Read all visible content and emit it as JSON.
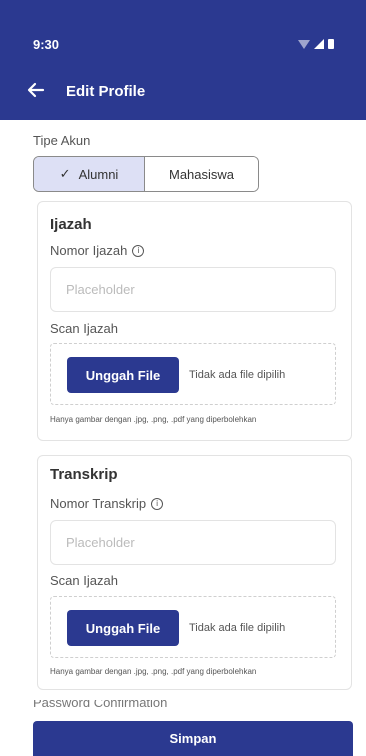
{
  "status_bar": {
    "time": "9:30",
    "icons": [
      "wifi-icon",
      "signal-icon",
      "battery-icon"
    ]
  },
  "app_bar": {
    "title": "Edit Profile",
    "back_icon": "arrow-left-icon"
  },
  "account_type": {
    "label": "Tipe Akun",
    "options": [
      "Alumni",
      "Mahasiswa"
    ],
    "selected": "Alumni",
    "check_glyph": "✓"
  },
  "ijazah": {
    "title": "Ijazah",
    "number_label": "Nomor Ijazah",
    "number_placeholder": "Placeholder",
    "scan_label": "Scan Ijazah",
    "upload_label": "Unggah File",
    "no_file_text": "Tidak ada file dipilih",
    "helper_text": "Hanya gambar dengan .jpg, .png, .pdf yang diperbolehkan"
  },
  "transkrip": {
    "title": "Transkrip",
    "number_label": "Nomor Transkrip",
    "number_placeholder": "Placeholder",
    "scan_label": "Scan Ijazah",
    "upload_label": "Unggah File",
    "no_file_text": "Tidak ada file dipilih",
    "helper_text": "Hanya gambar dengan .jpg, .png, .pdf yang diperbolehkan"
  },
  "next_section_label": "Password Confirmation",
  "submit_label": "Simpan",
  "colors": {
    "primary": "#2b3990",
    "selected_bg": "#dde0f5",
    "border": "#e3e3e3"
  }
}
